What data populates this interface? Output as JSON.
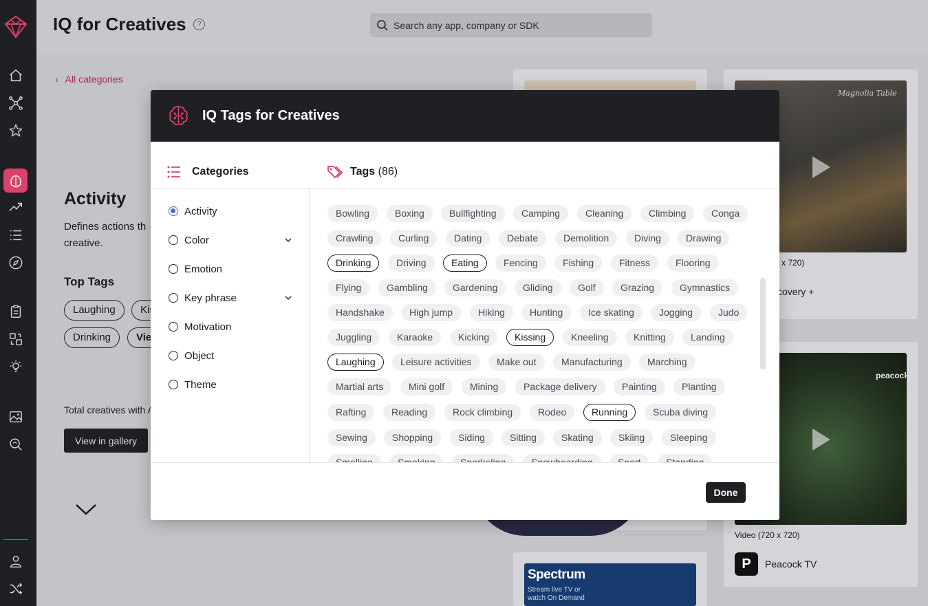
{
  "app": {
    "page_title": "IQ for Creatives",
    "search_placeholder": "Search any app, company or SDK"
  },
  "sidebar": {
    "items": [
      {
        "icon": "home-icon"
      },
      {
        "icon": "network-icon"
      },
      {
        "icon": "star-icon"
      },
      {
        "icon": "brain-icon",
        "active": true
      },
      {
        "icon": "trending-icon"
      },
      {
        "icon": "list-icon"
      },
      {
        "icon": "compass-icon"
      },
      {
        "icon": "clipboard-icon"
      },
      {
        "icon": "compare-icon"
      },
      {
        "icon": "lightbulb-icon"
      },
      {
        "icon": "image-icon"
      },
      {
        "icon": "search-icon"
      },
      {
        "icon": "user-icon"
      },
      {
        "icon": "shuffle-icon"
      }
    ],
    "accent": "#d8436a"
  },
  "background": {
    "back_link": "All categories",
    "category_title": "Activity",
    "description_line1": "Defines actions th",
    "description_line2": "creative.",
    "top_tags_heading": "Top Tags",
    "top_tags": [
      "Laughing",
      "Kis",
      "Drinking",
      "Vie"
    ],
    "total_text": "Total creatives with A",
    "view_gallery": "View in gallery",
    "cards": [
      {
        "meta": "x 720)",
        "name": "covery +"
      },
      {
        "meta": "Video (720 x 720)",
        "name": "Peacock TV",
        "brand": "peacock",
        "letter": "P"
      },
      {
        "brand": "Spectrum",
        "line1": "Stream live TV or",
        "line2": "watch On Demand",
        "watermark": "Magnolia Table"
      }
    ]
  },
  "modal": {
    "title": "IQ Tags for Creatives",
    "categories_label": "Categories",
    "tags_label": "Tags",
    "tags_count": "(86)",
    "categories": [
      {
        "label": "Activity",
        "checked": true,
        "expandable": false
      },
      {
        "label": "Color",
        "checked": false,
        "expandable": true
      },
      {
        "label": "Emotion",
        "checked": false,
        "expandable": false
      },
      {
        "label": "Key phrase",
        "checked": false,
        "expandable": true
      },
      {
        "label": "Motivation",
        "checked": false,
        "expandable": false
      },
      {
        "label": "Object",
        "checked": false,
        "expandable": false
      },
      {
        "label": "Theme",
        "checked": false,
        "expandable": false
      }
    ],
    "tag_rows": [
      [
        {
          "t": "Bowling"
        },
        {
          "t": "Boxing"
        },
        {
          "t": "Bullfighting"
        },
        {
          "t": "Camping"
        },
        {
          "t": "Cleaning"
        },
        {
          "t": "Climbing"
        },
        {
          "t": "Conga"
        }
      ],
      [
        {
          "t": "Crawling"
        },
        {
          "t": "Curling"
        },
        {
          "t": "Dating"
        },
        {
          "t": "Debate"
        },
        {
          "t": "Demolition"
        },
        {
          "t": "Diving"
        },
        {
          "t": "Drawing"
        }
      ],
      [
        {
          "t": "Drinking",
          "s": true
        },
        {
          "t": "Driving"
        },
        {
          "t": "Eating",
          "s": true
        },
        {
          "t": "Fencing"
        },
        {
          "t": "Fishing"
        },
        {
          "t": "Fitness"
        },
        {
          "t": "Flooring"
        }
      ],
      [
        {
          "t": "Flying"
        },
        {
          "t": "Gambling"
        },
        {
          "t": "Gardening"
        },
        {
          "t": "Gliding"
        },
        {
          "t": "Golf"
        },
        {
          "t": "Grazing"
        },
        {
          "t": "Gymnastics"
        }
      ],
      [
        {
          "t": "Handshake"
        },
        {
          "t": "High jump"
        },
        {
          "t": "Hiking"
        },
        {
          "t": "Hunting"
        },
        {
          "t": "Ice skating"
        },
        {
          "t": "Jogging"
        },
        {
          "t": "Judo"
        }
      ],
      [
        {
          "t": "Juggling"
        },
        {
          "t": "Karaoke"
        },
        {
          "t": "Kicking"
        },
        {
          "t": "Kissing",
          "s": true
        },
        {
          "t": "Kneeling"
        },
        {
          "t": "Knitting"
        },
        {
          "t": "Landing"
        }
      ],
      [
        {
          "t": "Laughing",
          "s": true
        },
        {
          "t": "Leisure activities"
        },
        {
          "t": "Make out"
        },
        {
          "t": "Manufacturing"
        },
        {
          "t": "Marching"
        }
      ],
      [
        {
          "t": "Martial arts"
        },
        {
          "t": "Mini golf"
        },
        {
          "t": "Mining"
        },
        {
          "t": "Package delivery"
        },
        {
          "t": "Painting"
        },
        {
          "t": "Planting"
        }
      ],
      [
        {
          "t": "Rafting"
        },
        {
          "t": "Reading"
        },
        {
          "t": "Rock climbing"
        },
        {
          "t": "Rodeo"
        },
        {
          "t": "Running",
          "s": true
        },
        {
          "t": "Scuba diving"
        }
      ],
      [
        {
          "t": "Sewing"
        },
        {
          "t": "Shopping"
        },
        {
          "t": "Siding"
        },
        {
          "t": "Sitting"
        },
        {
          "t": "Skating"
        },
        {
          "t": "Skiing"
        },
        {
          "t": "Sleeping"
        }
      ],
      [
        {
          "t": "Smelling"
        },
        {
          "t": "Smoking"
        },
        {
          "t": "Snorkeling"
        },
        {
          "t": "Snowboarding"
        },
        {
          "t": "Sport"
        },
        {
          "t": "Standing"
        }
      ]
    ],
    "done_label": "Done"
  }
}
